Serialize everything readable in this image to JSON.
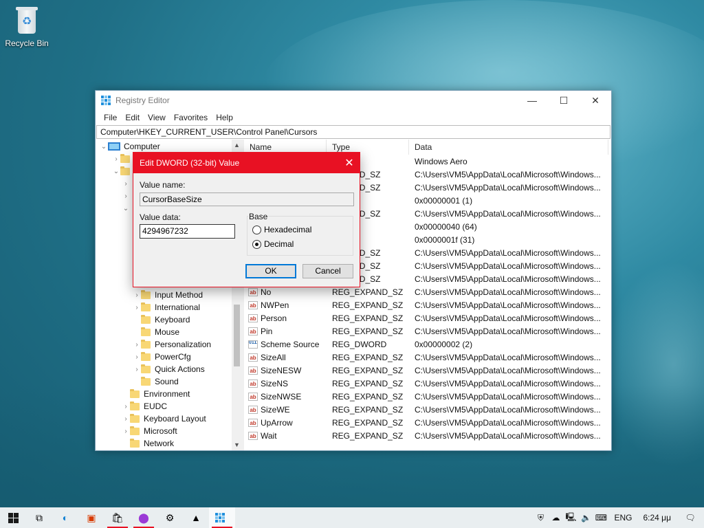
{
  "desktop": {
    "recycle_bin_label": "Recycle Bin"
  },
  "window": {
    "title": "Registry Editor",
    "controls": {
      "minimize": "—",
      "maximize": "☐",
      "close": "✕"
    },
    "menu": [
      "File",
      "Edit",
      "View",
      "Favorites",
      "Help"
    ],
    "address": "Computer\\HKEY_CURRENT_USER\\Control Panel\\Cursors"
  },
  "tree": {
    "root": "Computer",
    "items": [
      {
        "label": "Input Method",
        "level": 2,
        "expander": "›"
      },
      {
        "label": "International",
        "level": 2,
        "expander": "›"
      },
      {
        "label": "Keyboard",
        "level": 2,
        "expander": ""
      },
      {
        "label": "Mouse",
        "level": 2,
        "expander": ""
      },
      {
        "label": "Personalization",
        "level": 2,
        "expander": "›"
      },
      {
        "label": "PowerCfg",
        "level": 2,
        "expander": "›"
      },
      {
        "label": "Quick Actions",
        "level": 2,
        "expander": "›"
      },
      {
        "label": "Sound",
        "level": 2,
        "expander": ""
      },
      {
        "label": "Environment",
        "level": 1,
        "expander": ""
      },
      {
        "label": "EUDC",
        "level": 1,
        "expander": "›"
      },
      {
        "label": "Keyboard Layout",
        "level": 1,
        "expander": "›"
      },
      {
        "label": "Microsoft",
        "level": 1,
        "expander": "›"
      },
      {
        "label": "Network",
        "level": 1,
        "expander": ""
      }
    ]
  },
  "list": {
    "headers": {
      "name": "Name",
      "type": "Type",
      "data": "Data"
    },
    "rows": [
      {
        "name": "",
        "type": "",
        "data": "Windows Aero",
        "icon": "ab"
      },
      {
        "name": "",
        "type": "EXPAND_SZ",
        "data": "C:\\Users\\VM5\\AppData\\Local\\Microsoft\\Windows...",
        "icon": "ab"
      },
      {
        "name": "",
        "type": "EXPAND_SZ",
        "data": "C:\\Users\\VM5\\AppData\\Local\\Microsoft\\Windows...",
        "icon": "ab"
      },
      {
        "name": "",
        "type": "WORD",
        "data": "0x00000001 (1)",
        "icon": "bin"
      },
      {
        "name": "",
        "type": "EXPAND_SZ",
        "data": "C:\\Users\\VM5\\AppData\\Local\\Microsoft\\Windows...",
        "icon": "ab"
      },
      {
        "name": "",
        "type": "WORD",
        "data": "0x00000040 (64)",
        "icon": "bin"
      },
      {
        "name": "",
        "type": "WORD",
        "data": "0x0000001f (31)",
        "icon": "bin"
      },
      {
        "name": "",
        "type": "EXPAND_SZ",
        "data": "C:\\Users\\VM5\\AppData\\Local\\Microsoft\\Windows...",
        "icon": "ab"
      },
      {
        "name": "",
        "type": "EXPAND_SZ",
        "data": "C:\\Users\\VM5\\AppData\\Local\\Microsoft\\Windows...",
        "icon": "ab"
      },
      {
        "name": "",
        "type": "EXPAND_SZ",
        "data": "C:\\Users\\VM5\\AppData\\Local\\Microsoft\\Windows...",
        "icon": "ab"
      },
      {
        "name": "No",
        "type": "REG_EXPAND_SZ",
        "data": "C:\\Users\\VM5\\AppData\\Local\\Microsoft\\Windows...",
        "icon": "ab"
      },
      {
        "name": "NWPen",
        "type": "REG_EXPAND_SZ",
        "data": "C:\\Users\\VM5\\AppData\\Local\\Microsoft\\Windows...",
        "icon": "ab"
      },
      {
        "name": "Person",
        "type": "REG_EXPAND_SZ",
        "data": "C:\\Users\\VM5\\AppData\\Local\\Microsoft\\Windows...",
        "icon": "ab"
      },
      {
        "name": "Pin",
        "type": "REG_EXPAND_SZ",
        "data": "C:\\Users\\VM5\\AppData\\Local\\Microsoft\\Windows...",
        "icon": "ab"
      },
      {
        "name": "Scheme Source",
        "type": "REG_DWORD",
        "data": "0x00000002 (2)",
        "icon": "bin"
      },
      {
        "name": "SizeAll",
        "type": "REG_EXPAND_SZ",
        "data": "C:\\Users\\VM5\\AppData\\Local\\Microsoft\\Windows...",
        "icon": "ab"
      },
      {
        "name": "SizeNESW",
        "type": "REG_EXPAND_SZ",
        "data": "C:\\Users\\VM5\\AppData\\Local\\Microsoft\\Windows...",
        "icon": "ab"
      },
      {
        "name": "SizeNS",
        "type": "REG_EXPAND_SZ",
        "data": "C:\\Users\\VM5\\AppData\\Local\\Microsoft\\Windows...",
        "icon": "ab"
      },
      {
        "name": "SizeNWSE",
        "type": "REG_EXPAND_SZ",
        "data": "C:\\Users\\VM5\\AppData\\Local\\Microsoft\\Windows...",
        "icon": "ab"
      },
      {
        "name": "SizeWE",
        "type": "REG_EXPAND_SZ",
        "data": "C:\\Users\\VM5\\AppData\\Local\\Microsoft\\Windows...",
        "icon": "ab"
      },
      {
        "name": "UpArrow",
        "type": "REG_EXPAND_SZ",
        "data": "C:\\Users\\VM5\\AppData\\Local\\Microsoft\\Windows...",
        "icon": "ab"
      },
      {
        "name": "Wait",
        "type": "REG_EXPAND_SZ",
        "data": "C:\\Users\\VM5\\AppData\\Local\\Microsoft\\Windows...",
        "icon": "ab"
      }
    ]
  },
  "dialog": {
    "title": "Edit DWORD (32-bit) Value",
    "close": "✕",
    "value_name_label": "Value name:",
    "value_name": "CursorBaseSize",
    "value_data_label": "Value data:",
    "value_data": "4294967232",
    "base_label": "Base",
    "radio_hex": "Hexadecimal",
    "radio_dec": "Decimal",
    "selected_base": "Decimal",
    "ok": "OK",
    "cancel": "Cancel"
  },
  "taskbar": {
    "language": "ENG",
    "time": "6:24 μμ"
  },
  "colors": {
    "accent_red": "#e81123",
    "focus_blue": "#0078d7"
  }
}
